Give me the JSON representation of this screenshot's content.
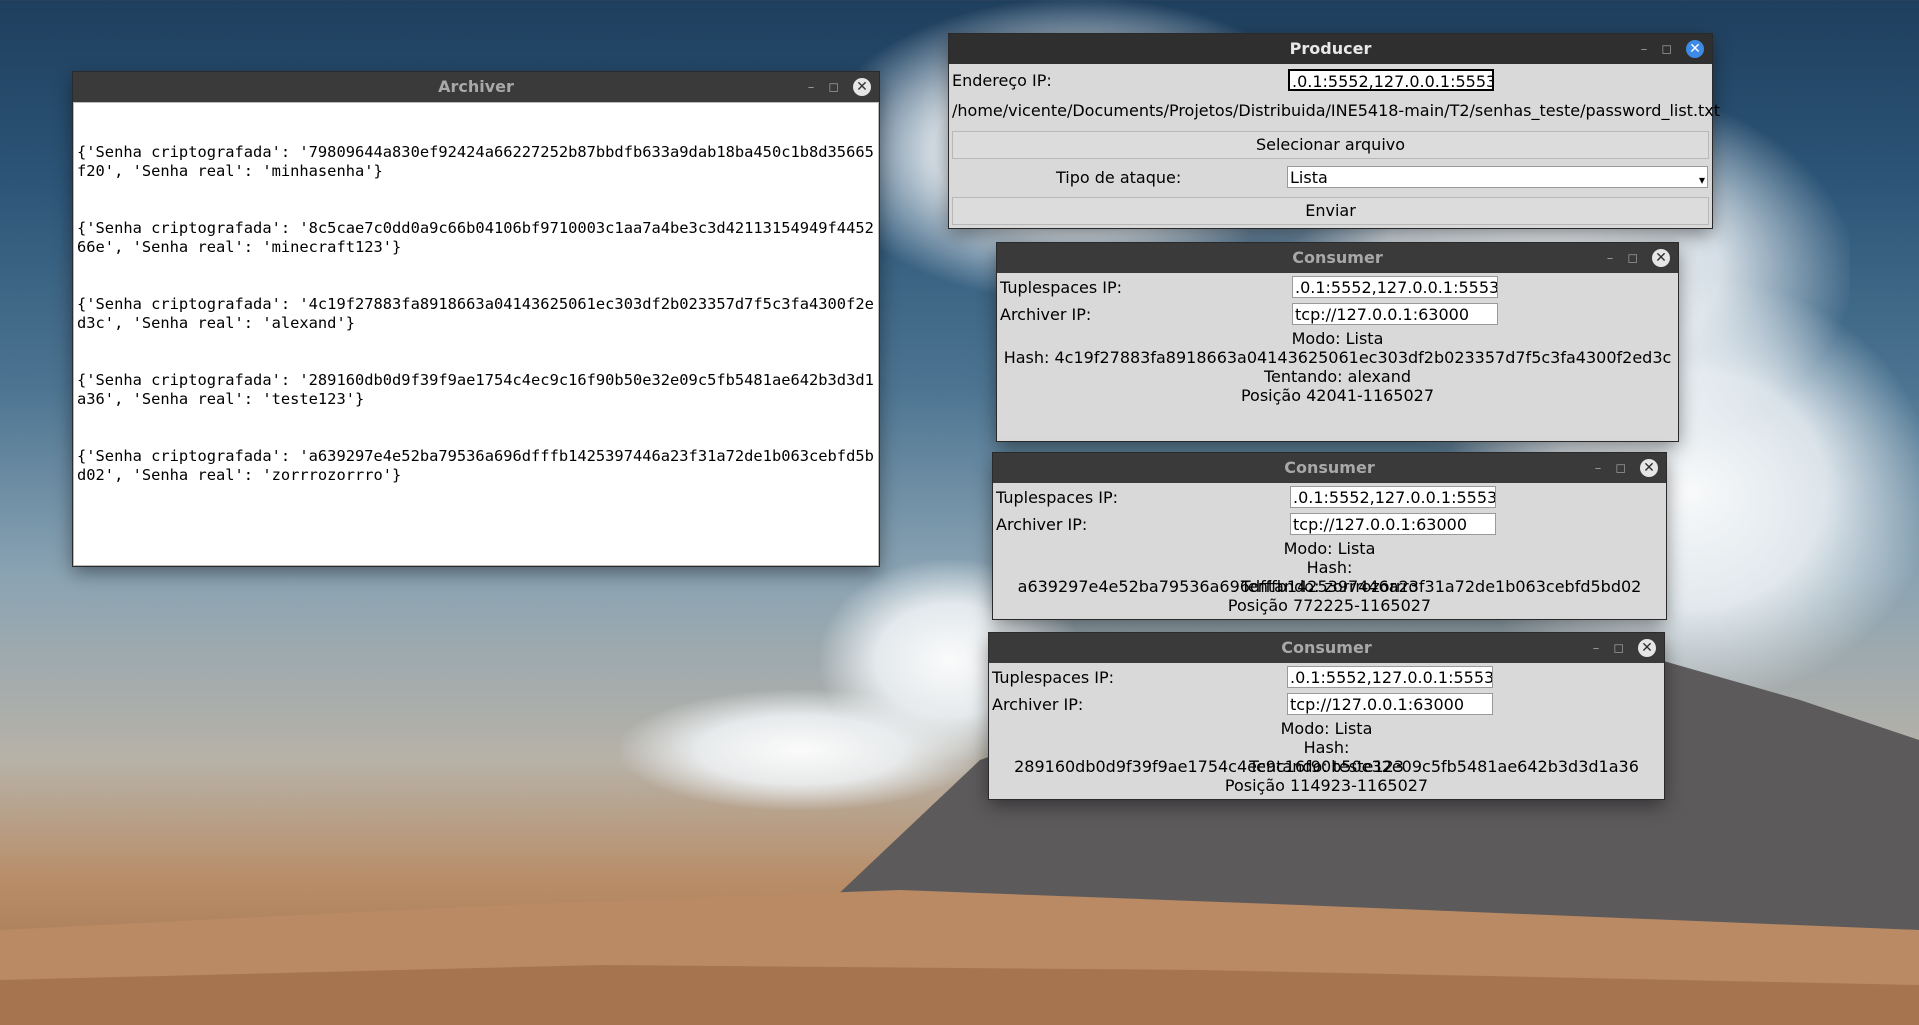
{
  "archiver": {
    "title": "Archiver",
    "log_lines": [
      "{'Senha criptografada': '79809644a830ef92424a66227252b87bbdfb633a9dab18ba450c1b8d35665f20', 'Senha real': 'minhasenha'}",
      "{'Senha criptografada': '8c5cae7c0dd0a9c66b04106bf9710003c1aa7a4be3c3d42113154949f445266e', 'Senha real': 'minecraft123'}",
      "{'Senha criptografada': '4c19f27883fa8918663a04143625061ec303df2b023357d7f5c3fa4300f2ed3c', 'Senha real': 'alexand'}",
      "{'Senha criptografada': '289160db0d9f39f9ae1754c4ec9c16f90b50e32e09c5fb5481ae642b3d3d1a36', 'Senha real': 'teste123'}",
      "{'Senha criptografada': 'a639297e4e52ba79536a696dfffb1425397446a23f31a72de1b063cebfd5bd02', 'Senha real': 'zorrrozorrro'}"
    ]
  },
  "producer": {
    "title": "Producer",
    "ip_label": "Endereço IP:",
    "ip_value": ".0.1:5552,127.0.0.1:5553",
    "file_path": "/home/vicente/Documents/Projetos/Distribuida/INE5418-main/T2/senhas_teste/password_list.txt",
    "select_file_label": "Selecionar arquivo",
    "attack_type_label": "Tipo de ataque:",
    "attack_type_value": "Lista",
    "send_label": "Enviar"
  },
  "consumers": [
    {
      "title": "Consumer",
      "tuplespaces_label": "Tuplespaces IP:",
      "tuplespaces_value": ".0.1:5552,127.0.0.1:5553",
      "archiver_label": "Archiver IP:",
      "archiver_value": "tcp://127.0.0.1:63000",
      "mode": "Modo: Lista",
      "hash": "Hash: 4c19f27883fa8918663a04143625061ec303df2b023357d7f5c3fa4300f2ed3c",
      "trying": "Tentando: alexand",
      "position": "Posição 42041-1165027"
    },
    {
      "title": "Consumer",
      "tuplespaces_label": "Tuplespaces IP:",
      "tuplespaces_value": ".0.1:5552,127.0.0.1:5553",
      "archiver_label": "Archiver IP:",
      "archiver_value": "tcp://127.0.0.1:63000",
      "mode": "Modo: Lista",
      "hash": "Hash: a639297e4e52ba79536a696dfffb1425397446a23f31a72de1b063cebfd5bd02",
      "trying": "Tentando: zorrrozorrro",
      "position": "Posição 772225-1165027"
    },
    {
      "title": "Consumer",
      "tuplespaces_label": "Tuplespaces IP:",
      "tuplespaces_value": ".0.1:5552,127.0.0.1:5553",
      "archiver_label": "Archiver IP:",
      "archiver_value": "tcp://127.0.0.1:63000",
      "mode": "Modo: Lista",
      "hash": "Hash: 289160db0d9f39f9ae1754c4ec9c16f90b50e32e09c5fb5481ae642b3d3d1a36",
      "trying": "Tentando: teste123",
      "position": "Posição 114923-1165027"
    }
  ],
  "icons": {
    "minimize": "–",
    "maximize": "◻",
    "close": "✕",
    "dropdown": "▾"
  }
}
